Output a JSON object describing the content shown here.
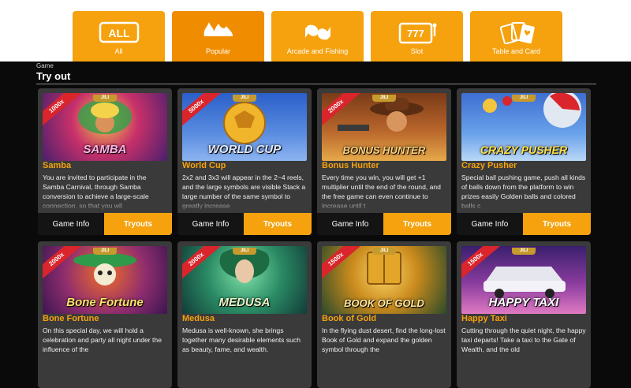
{
  "nav": {
    "tabs": [
      {
        "label": "All",
        "icon": "all-icon"
      },
      {
        "label": "Popular",
        "icon": "hot-flame-icon"
      },
      {
        "label": "Arcade and Fishing",
        "icon": "fish-icon"
      },
      {
        "label": "Slot",
        "icon": "slot-machine-icon"
      },
      {
        "label": "Table and Card",
        "icon": "playing-cards-icon"
      }
    ],
    "active": "Popular",
    "all_icon_text": "ALL",
    "hot_icon_text": "HOT",
    "slot_icon_text": "777"
  },
  "breadcrumb": "Game",
  "section_title": "Try out",
  "buttons": {
    "info": "Game Info",
    "try": "Tryouts"
  },
  "games": [
    {
      "name": "Samba",
      "multiplier": "1000x",
      "brand": "JILI",
      "art_title": "SAMBA",
      "desc": "You are invited to participate in the Samba Carnival, through Samba conversion to achieve a large-scale connection, so that you wil"
    },
    {
      "name": "World Cup",
      "multiplier": "5000x",
      "brand": "JILI",
      "art_title": "WORLD CUP",
      "desc": "2x2 and 3x3 will appear in the 2~4 reels, and the large symbols are visible Stack a large number of the same symbol to greatly increase"
    },
    {
      "name": "Bonus Hunter",
      "multiplier": "2000x",
      "brand": "JILI",
      "art_title": "BONUS HUNTER",
      "desc": "Every time you win, you will get +1 multiplier until the end of the round, and the free game can even continue to increase until t"
    },
    {
      "name": "Crazy Pusher",
      "multiplier": "",
      "brand": "JILI",
      "art_title": "CRAZY PUSHER",
      "desc": "Special ball pushing game, push all kinds of balls down from the platform to win prizes easily Golden balls and colored balls c"
    },
    {
      "name": "Bone Fortune",
      "multiplier": "2000x",
      "brand": "JILI",
      "art_title": "Bone Fortune",
      "desc": "On this special day, we will hold a celebration and party all night under the influence of the"
    },
    {
      "name": "Medusa",
      "multiplier": "2000x",
      "brand": "JILI",
      "art_title": "MEDUSA",
      "desc": "Medusa is well-known, she brings together many desirable elements such as beauty, fame, and wealth."
    },
    {
      "name": "Book of Gold",
      "multiplier": "1500x",
      "brand": "JILI",
      "art_title": "BOOK OF GOLD",
      "desc": "In the flying dust desert, find the long-lost Book of Gold and expand the golden symbol through the"
    },
    {
      "name": "Happy Taxi",
      "multiplier": "1500x",
      "brand": "JILI",
      "art_title": "HAPPY TAXI",
      "desc": "Cutting through the quiet night, the happy taxi departs! Take a taxi to the Gate of Wealth, and the old"
    }
  ],
  "colors": {
    "accent": "#f5a20e",
    "card_bg": "#3a3a3a",
    "ribbon": "#d9252b",
    "page_bg": "#0a0a0a"
  }
}
